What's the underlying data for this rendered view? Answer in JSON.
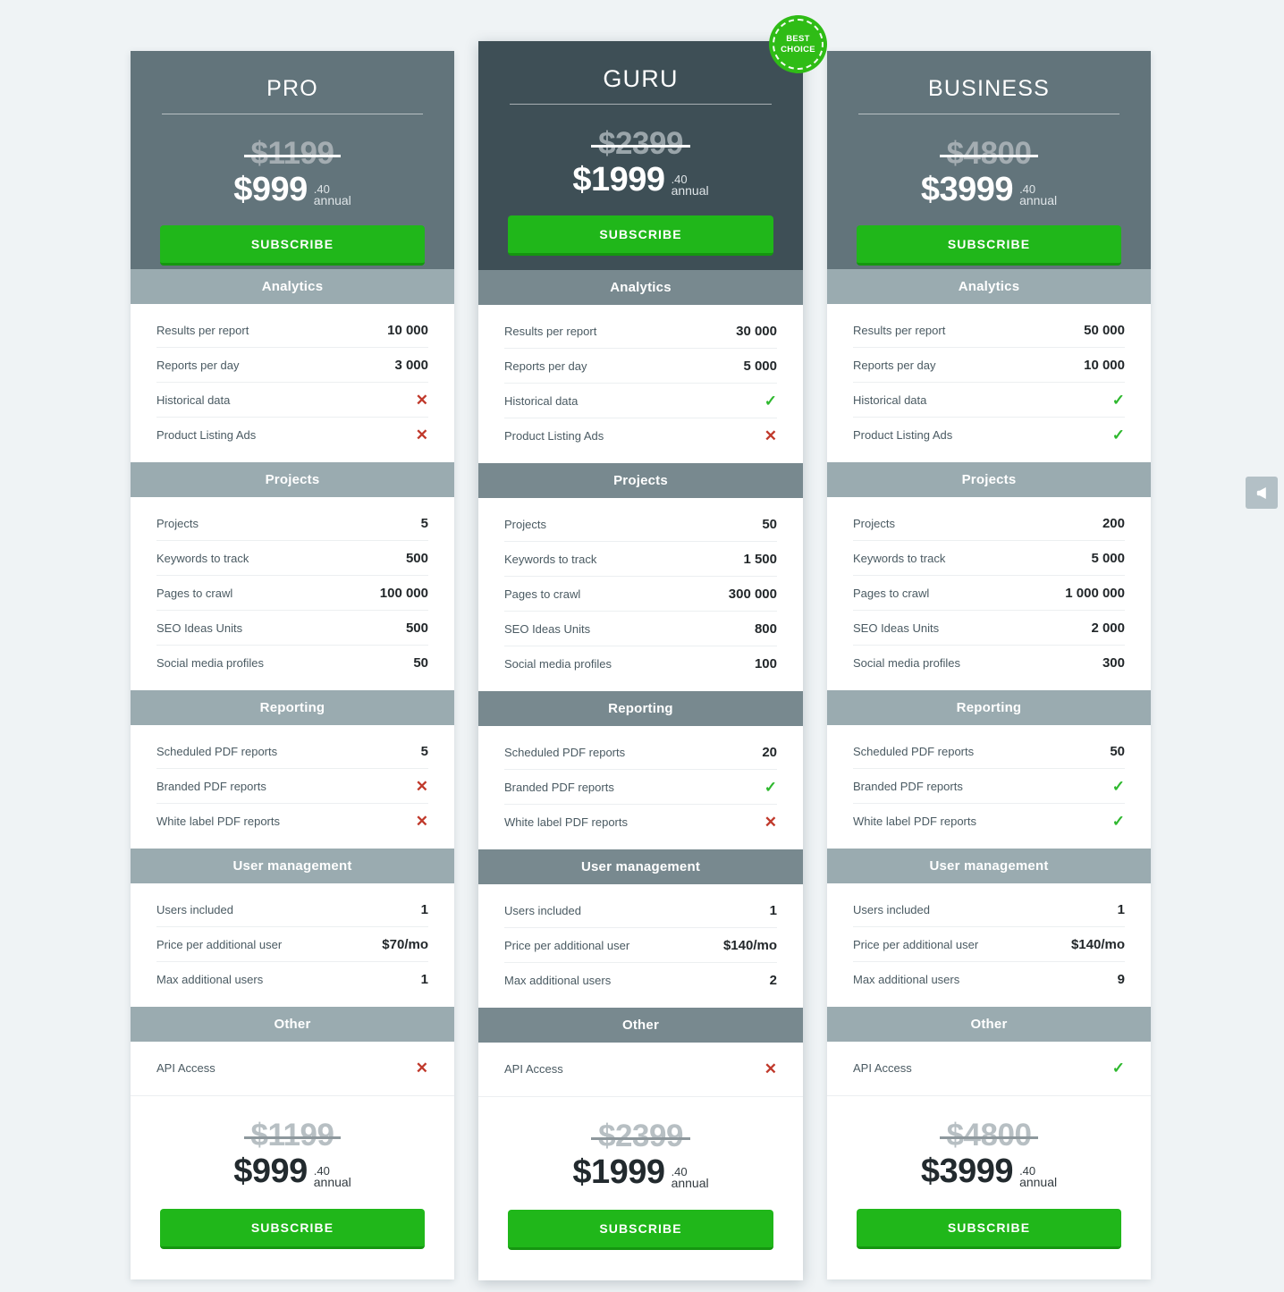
{
  "badge": {
    "line1": "BEST",
    "line2": "CHOICE"
  },
  "side_widget": {
    "icon": "megaphone-icon"
  },
  "colors": {
    "page_background": "#eff3f5",
    "header_standard": "#62747b",
    "header_featured": "#3e4f56",
    "section_standard": "#9aabb0",
    "section_featured": "#78898f",
    "subscribe_green": "#20b71a",
    "check_green": "#2eb82e",
    "cross_red": "#c0392b",
    "badge_green": "#2fbc16"
  },
  "labels": {
    "subscribe": "SUBSCRIBE",
    "cents": ".40",
    "period": "annual"
  },
  "sections": [
    {
      "title": "Analytics",
      "rows": [
        "Results per report",
        "Reports per day",
        "Historical data",
        "Product Listing Ads"
      ]
    },
    {
      "title": "Projects",
      "rows": [
        "Projects",
        "Keywords to track",
        "Pages to crawl",
        "SEO Ideas Units",
        "Social media profiles"
      ]
    },
    {
      "title": "Reporting",
      "rows": [
        "Scheduled PDF reports",
        "Branded PDF reports",
        "White label PDF reports"
      ]
    },
    {
      "title": "User management",
      "rows": [
        "Users included",
        "Price per additional user",
        "Max additional users"
      ]
    },
    {
      "title": "Other",
      "rows": [
        "API Access"
      ]
    }
  ],
  "plans": [
    {
      "name": "PRO",
      "featured": false,
      "price_old": "$1199",
      "price_now": "$999",
      "cents": ".40",
      "period": "annual",
      "subscribe": "SUBSCRIBE",
      "values": [
        [
          "10 000",
          "3 000",
          "no",
          "no"
        ],
        [
          "5",
          "500",
          "100 000",
          "500",
          "50"
        ],
        [
          "5",
          "no",
          "no"
        ],
        [
          "1",
          "$70/mo",
          "1"
        ],
        [
          "no"
        ]
      ]
    },
    {
      "name": "GURU",
      "featured": true,
      "price_old": "$2399",
      "price_now": "$1999",
      "cents": ".40",
      "period": "annual",
      "subscribe": "SUBSCRIBE",
      "values": [
        [
          "30 000",
          "5 000",
          "yes",
          "no"
        ],
        [
          "50",
          "1 500",
          "300 000",
          "800",
          "100"
        ],
        [
          "20",
          "yes",
          "no"
        ],
        [
          "1",
          "$140/mo",
          "2"
        ],
        [
          "no"
        ]
      ]
    },
    {
      "name": "BUSINESS",
      "featured": false,
      "price_old": "$4800",
      "price_now": "$3999",
      "cents": ".40",
      "period": "annual",
      "subscribe": "SUBSCRIBE",
      "values": [
        [
          "50 000",
          "10 000",
          "yes",
          "yes"
        ],
        [
          "200",
          "5 000",
          "1 000 000",
          "2 000",
          "300"
        ],
        [
          "50",
          "yes",
          "yes"
        ],
        [
          "1",
          "$140/mo",
          "9"
        ],
        [
          "yes"
        ]
      ]
    }
  ]
}
